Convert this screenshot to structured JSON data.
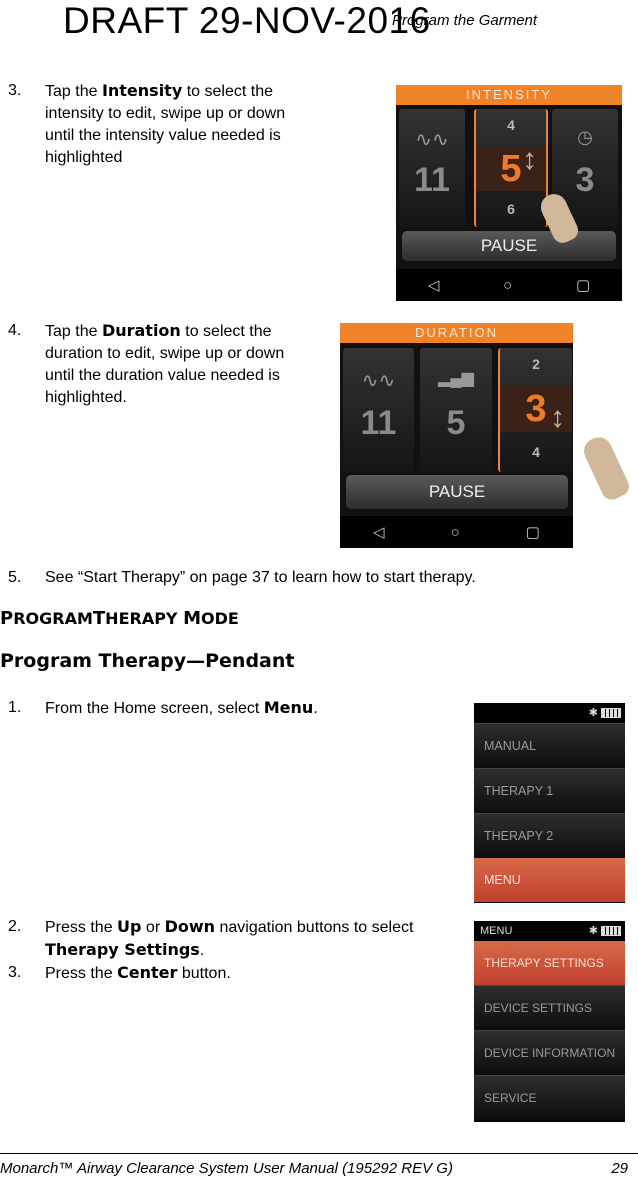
{
  "header": {
    "draft_stamp": "DRAFT 29-NOV-2016",
    "running_head": "Program the Garment"
  },
  "steps_top": [
    {
      "num": "3.",
      "pre": "Tap the ",
      "kw": "Intensity",
      "post": " to select the intensity to edit, swipe up or down until the intensity value needed is highlighted"
    },
    {
      "num": "4.",
      "pre": "Tap the ",
      "kw": "Duration",
      "post": " to select the duration to edit, swipe up or down until the duration value needed is highlighted."
    },
    {
      "num": "5.",
      "text": "See “Start Therapy” on page 37 to learn how to start therapy."
    }
  ],
  "intensity_screen": {
    "title": "INTENSITY",
    "frequency_value": "11",
    "intensity_above": "4",
    "intensity_selected": "5",
    "intensity_below": "6",
    "duration_value": "3",
    "pause_label": "PAUSE",
    "nav": {
      "back": "◁",
      "home": "○",
      "recent": "▢"
    },
    "accent_color": "#f0822a"
  },
  "duration_screen": {
    "title": "DURATION",
    "frequency_value": "11",
    "intensity_value": "5",
    "duration_above": "2",
    "duration_selected": "3",
    "duration_below": "4",
    "pause_label": "PAUSE",
    "nav": {
      "back": "◁",
      "home": "○",
      "recent": "▢"
    }
  },
  "section_heading": {
    "p": "P",
    "rogram": "ROGRAM",
    "t": "T",
    "herapy": "HERAPY",
    "m": "M",
    "ode": "ODE"
  },
  "subheading": "Program Therapy—Pendant",
  "steps_bottom": [
    {
      "num": "1.",
      "pre": "From the Home screen, select ",
      "kw": "Menu",
      "post": "."
    },
    {
      "num": "2.",
      "pre": "Press the ",
      "kw": "Up",
      "mid": " or ",
      "kw2": "Down",
      "post": " navigation buttons to select ",
      "kw3": "Therapy Settings",
      "post2": "."
    },
    {
      "num": "3.",
      "pre": "Press the ",
      "kw": "Center",
      "post": " button."
    }
  ],
  "pendant_home": {
    "status_icons": [
      "bluetooth-icon",
      "battery-icon"
    ],
    "bluetooth": "✱",
    "items": [
      "MANUAL",
      "THERAPY 1",
      "THERAPY 2",
      "MENU"
    ],
    "active_index": 3
  },
  "pendant_menu": {
    "title": "MENU",
    "bluetooth": "✱",
    "items": [
      "THERAPY SETTINGS",
      "DEVICE SETTINGS",
      "DEVICE INFORMATION",
      "SERVICE"
    ],
    "active_index": 0
  },
  "footer": {
    "text": "Monarch™ Airway Clearance System User Manual (195292 REV G)",
    "page": "29"
  }
}
